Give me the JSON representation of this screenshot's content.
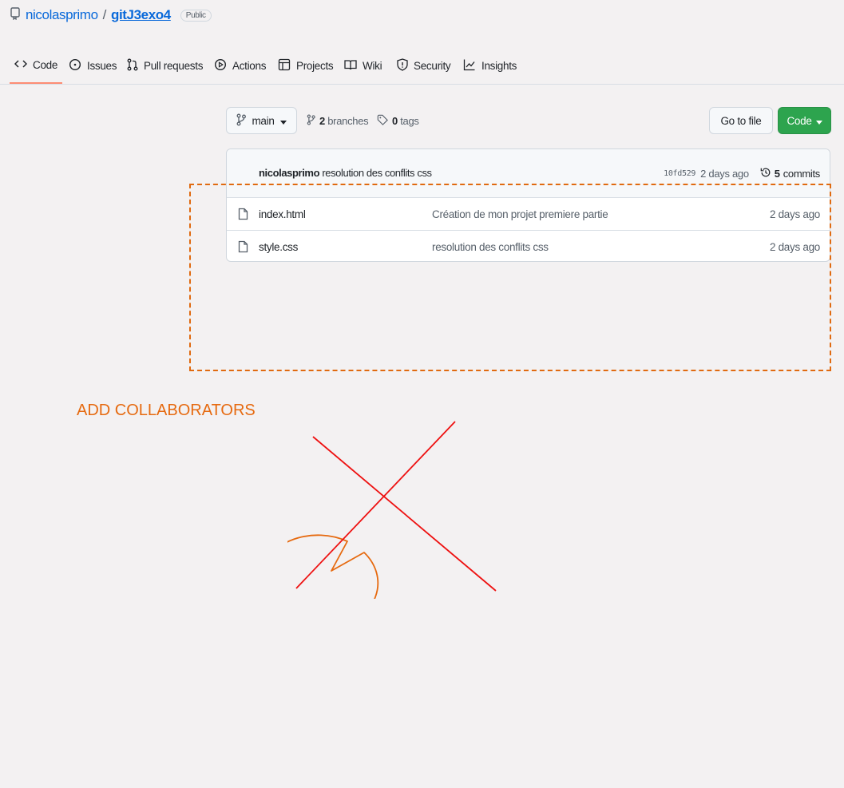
{
  "repo": {
    "owner": "nicolasprimo",
    "separator": "/",
    "name": "gitJ3exo4",
    "visibility": "Public"
  },
  "tabs": [
    {
      "label": "Code",
      "icon": "code-icon",
      "active": true
    },
    {
      "label": "Issues",
      "icon": "issue-opened-icon"
    },
    {
      "label": "Pull requests",
      "icon": "git-pull-request-icon"
    },
    {
      "label": "Actions",
      "icon": "play-icon"
    },
    {
      "label": "Projects",
      "icon": "table-icon"
    },
    {
      "label": "Wiki",
      "icon": "book-icon"
    },
    {
      "label": "Security",
      "icon": "shield-icon"
    },
    {
      "label": "Insights",
      "icon": "graph-icon"
    }
  ],
  "toolbar": {
    "branch": "main",
    "branches_count": "2",
    "branches_label": "branches",
    "tags_count": "0",
    "tags_label": "tags",
    "go_to_file": "Go to file",
    "code_button": "Code"
  },
  "latest_commit": {
    "author": "nicolasprimo",
    "message": "resolution des conflits css",
    "sha": "10fd529",
    "age": "2 days ago",
    "commits_count": "5",
    "commits_label": "commits"
  },
  "files": [
    {
      "name": "index.html",
      "message": "Création de mon projet premiere partie",
      "age": "2 days ago",
      "icon": "file-icon"
    },
    {
      "name": "style.css",
      "message": "resolution des conflits css",
      "age": "2 days ago",
      "icon": "file-icon"
    }
  ],
  "annotation": {
    "text": "ADD COLLABORATORS",
    "color": "#e66a10",
    "cross_color": "#ee1111"
  },
  "colors": {
    "link": "#0969da",
    "active_tab_underline": "#fd8c73",
    "green_button": "#2da44e"
  }
}
